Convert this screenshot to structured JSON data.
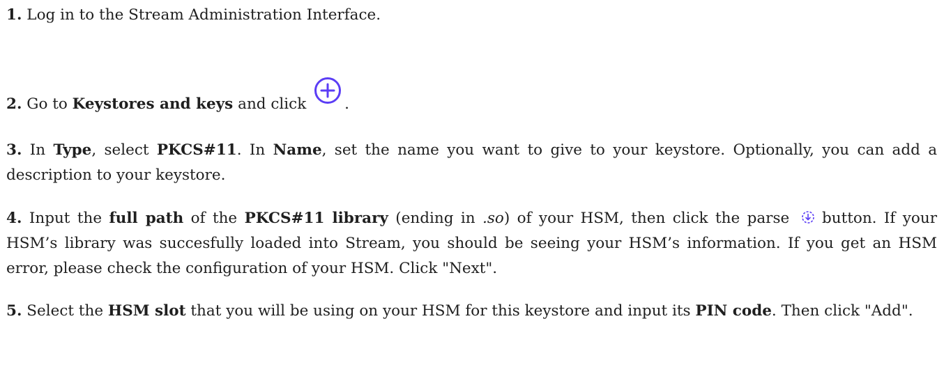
{
  "steps": [
    {
      "num": "1.",
      "text_a": " Log in to the Stream Administration Interface."
    },
    {
      "num": "2.",
      "text_a": " Go to ",
      "bold_a": "Keystores and keys",
      "text_b": " and click ",
      "icon": "add-circle-icon",
      "text_c": "."
    },
    {
      "num": "3.",
      "text_a": " In ",
      "bold_a": "Type",
      "text_b": ", select ",
      "bold_b": "PKCS#11",
      "text_c": ". In ",
      "bold_c": "Name",
      "text_d": ", set the name you want to give to your keystore. Optionally, you can add a description to your keystore."
    },
    {
      "num": "4.",
      "text_a": " Input the ",
      "bold_a": "full path",
      "text_b": " of the ",
      "bold_b": "PKCS#11 library",
      "text_c": " (ending in ",
      "italic_a": ".so",
      "text_d": ") of your HSM, then click the parse ",
      "icon": "parse-icon",
      "text_e": " button. If your HSM’s library was succesfully loaded into Stream, you should be seeing your HSM’s information. If you get an HSM error, please check the configuration of your HSM. Click \"Next\"."
    },
    {
      "num": "5.",
      "text_a": " Select the ",
      "bold_a": "HSM slot",
      "text_b": " that you will be using on your HSM for this keystore and input its ",
      "bold_b": "PIN code",
      "text_c": ". Then click \"Add\"."
    }
  ],
  "colors": {
    "text": "#1f1f1f",
    "icon": "#5b3df5"
  }
}
